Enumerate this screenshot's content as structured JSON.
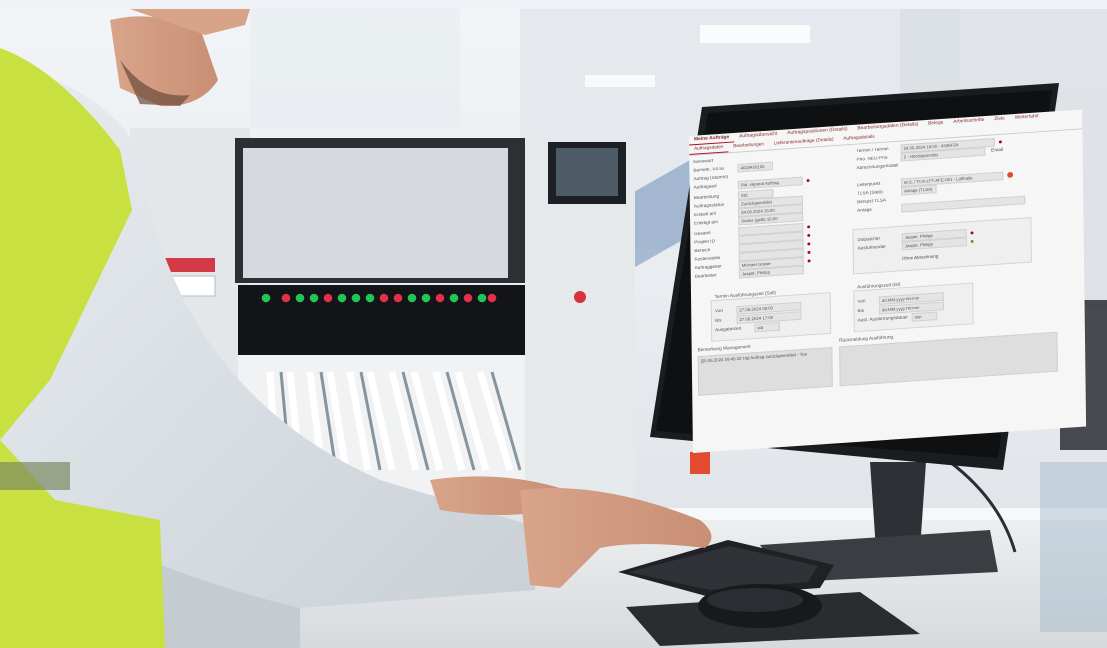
{
  "scene": {
    "description_icons": [
      "worker",
      "monitor",
      "keyboard",
      "mouse",
      "pick-and-place-machine"
    ]
  },
  "screen": {
    "tabs": [
      "Meine Aufträge",
      "Auftragsübersicht",
      "Auftragspositionen (Details)",
      "Bearbeitungsdaten (Details)",
      "Belege",
      "Arbeitsschritte",
      "Ziele",
      "Weiterfahrt"
    ],
    "subtabs": [
      "Auftragsdaten",
      "Bearbeitungen",
      "Lieferantenaufträge (Details)",
      "Auftragsdetails"
    ],
    "form_left": [
      {
        "label": "Kennwort",
        "value": ""
      },
      {
        "label": "Bemerk. V4.5x",
        "value": "4024450125"
      },
      {
        "label": "Auftrag (Stamm)",
        "value": ""
      },
      {
        "label": "Auftragsart",
        "value": "Std. separat Auftrag"
      },
      {
        "label": "Bearbeitung",
        "value": "Std."
      },
      {
        "label": "Auftragsstatus",
        "value": "Zurückgemeldet"
      },
      {
        "label": "Erstellt am",
        "value": "24.06.2024 15:00"
      },
      {
        "label": "Erledigt am",
        "value": "Status (gelb) 15:00"
      },
      {
        "label": "Gesamt",
        "value": ""
      },
      {
        "label": "Projekt ID",
        "value": ""
      },
      {
        "label": "Bereich",
        "value": ""
      },
      {
        "label": "Kostenstelle",
        "value": ""
      },
      {
        "label": "Auftraggeber",
        "value": "Michael Grewe"
      },
      {
        "label": "Bearbeiter",
        "value": "Jasper, Philipp"
      }
    ],
    "form_right": [
      {
        "label": "Termin / Termin",
        "value": "24.06.2024 18:00 - 4346F2A"
      },
      {
        "label": "Prio. NEU-Prio",
        "value": "2 - Höchstpriorität"
      },
      {
        "label": "Abrechnungsmodell",
        "value": ""
      },
      {
        "label": "Lieferpunkt",
        "value": "M.S. / TCA-LFT-AFE-001 - Lufthalle"
      },
      {
        "label": "TLSA (Steb)",
        "value": "Anlage (TLSA)"
      },
      {
        "label": "Benutzt TLSA",
        "value": ""
      },
      {
        "label": "Anlage",
        "value": ""
      },
      {
        "label": "Dispatcher",
        "value": "Jasper, Philipp"
      },
      {
        "label": "Ausführender",
        "value": "Jasper, Philipp"
      },
      {
        "label": "Option",
        "value": "Ohne Abrechnung"
      }
    ],
    "group_terms": {
      "title": "Termin Ausführungszeit (Soll)",
      "von_label": "Von",
      "von": "27.06.2024 08:00",
      "bis_label": "Bis",
      "bis": "27.06.2024 17:00",
      "dauer_label": "Ausgabezeit",
      "dauer": "std"
    },
    "group_actual": {
      "title": "Ausführungszeit (Ist)",
      "von_label": "Von",
      "von": "dd.MM.yyyy hh:mm",
      "bis_label": "Bis",
      "bis": "dd.MM.yyyy hh:mm",
      "dauer_label": "Ausf. Ausführungsdauer",
      "dauer": "min"
    },
    "notes": {
      "left_title": "Bemerkung Management",
      "left_text": "[25.06.2024 09:45:32 Hq] Auftrag zurückgemeldet - Tue",
      "right_title": "Rückmeldung Ausführung"
    },
    "email_label": "Email"
  },
  "colors": {
    "accent_red": "#b00020",
    "vest_yellow": "#c8e040",
    "led_green": "#22c45a",
    "led_red": "#e0304a"
  }
}
